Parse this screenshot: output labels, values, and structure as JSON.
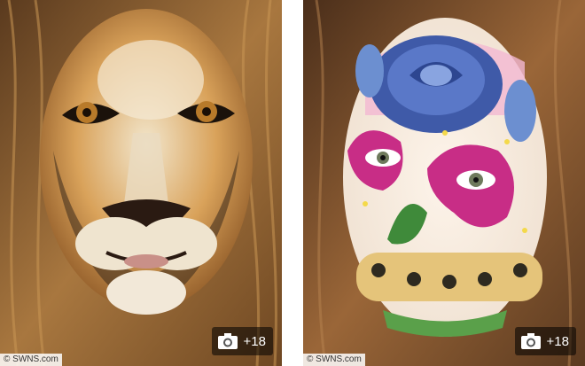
{
  "photos": [
    {
      "subject": "lion face paint",
      "credit": "© SWNS.com",
      "gallery_count": "+18",
      "icon": "camera-icon"
    },
    {
      "subject": "floral face paint",
      "credit": "© SWNS.com",
      "gallery_count": "+18",
      "icon": "camera-icon"
    }
  ]
}
